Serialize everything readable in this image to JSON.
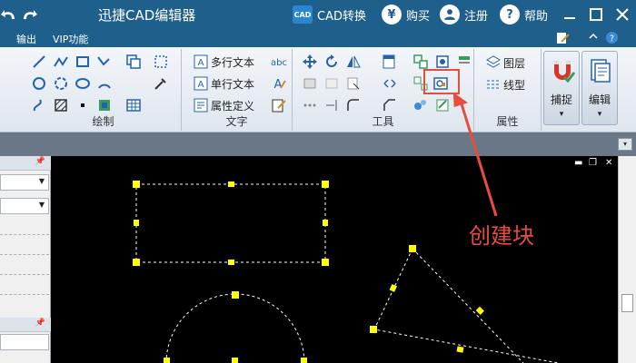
{
  "titlebar": {
    "title": "迅捷CAD编辑器",
    "cad_badge": "CAD",
    "convert_label": "CAD转换",
    "buy_label": "购买",
    "register_label": "注册",
    "help_label": "帮助",
    "buy_glyph": "¥",
    "help_glyph": "?"
  },
  "menubar": {
    "items": [
      "输出",
      "VIP功能"
    ]
  },
  "ribbon": {
    "groups": {
      "draw": "绘制",
      "text": "文字",
      "tools": "工具",
      "properties": "属性"
    },
    "text_items": [
      "多行文本",
      "单行文本",
      "属性定义"
    ],
    "property_items": [
      "图层",
      "线型"
    ],
    "big_buttons": [
      "捕捉",
      "编辑"
    ]
  },
  "annotation": "创建块",
  "colors": {
    "titlebar": "#1f5f8c",
    "highlight": "#e74c3c",
    "grip": "#ffff00"
  }
}
